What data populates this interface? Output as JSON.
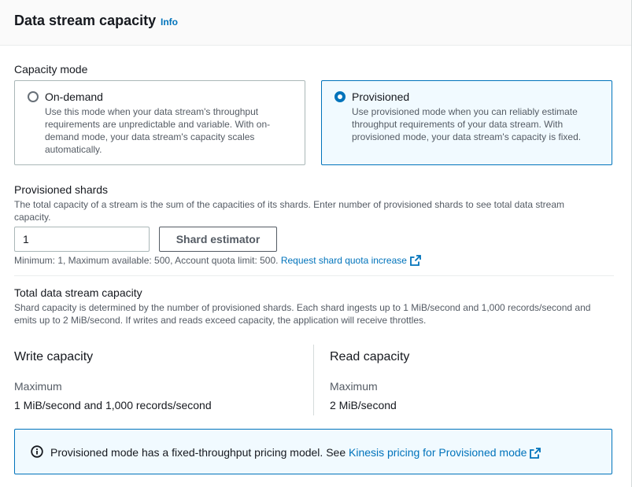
{
  "header": {
    "title": "Data stream capacity",
    "info_label": "Info"
  },
  "capacity_mode": {
    "label": "Capacity mode",
    "options": [
      {
        "label": "On-demand",
        "description": "Use this mode when your data stream's throughput requirements are unpredictable and variable. With on-demand mode, your data stream's capacity scales automatically.",
        "selected": false
      },
      {
        "label": "Provisioned",
        "description": "Use provisioned mode when you can reliably estimate throughput requirements of your data stream. With provisioned mode, your data stream's capacity is fixed.",
        "selected": true
      }
    ]
  },
  "provisioned_shards": {
    "label": "Provisioned shards",
    "description": "The total capacity of a stream is the sum of the capacities of its shards. Enter number of provisioned shards to see total data stream capacity.",
    "value": "1",
    "estimator_button": "Shard estimator",
    "constraint_text": "Minimum: 1, Maximum available: 500, Account quota limit: 500.",
    "quota_link": "Request shard quota increase"
  },
  "total_capacity": {
    "label": "Total data stream capacity",
    "description": "Shard capacity is determined by the number of provisioned shards. Each shard ingests up to 1 MiB/second and 1,000 records/second and emits up to 2 MiB/second. If writes and reads exceed capacity, the application will receive throttles.",
    "write": {
      "label": "Write capacity",
      "sub_label": "Maximum",
      "value": "1 MiB/second and 1,000 records/second"
    },
    "read": {
      "label": "Read capacity",
      "sub_label": "Maximum",
      "value": "2 MiB/second"
    }
  },
  "alert": {
    "text": "Provisioned mode has a fixed-throughput pricing model. See",
    "link": "Kinesis pricing for Provisioned mode"
  },
  "colors": {
    "link": "#0073bb",
    "selected_border": "#0073bb",
    "selected_bg": "#f1faff",
    "text": "#16191f",
    "muted": "#545b64"
  },
  "icons": {
    "external_link": "external-link-icon",
    "info": "info-circle-icon"
  }
}
